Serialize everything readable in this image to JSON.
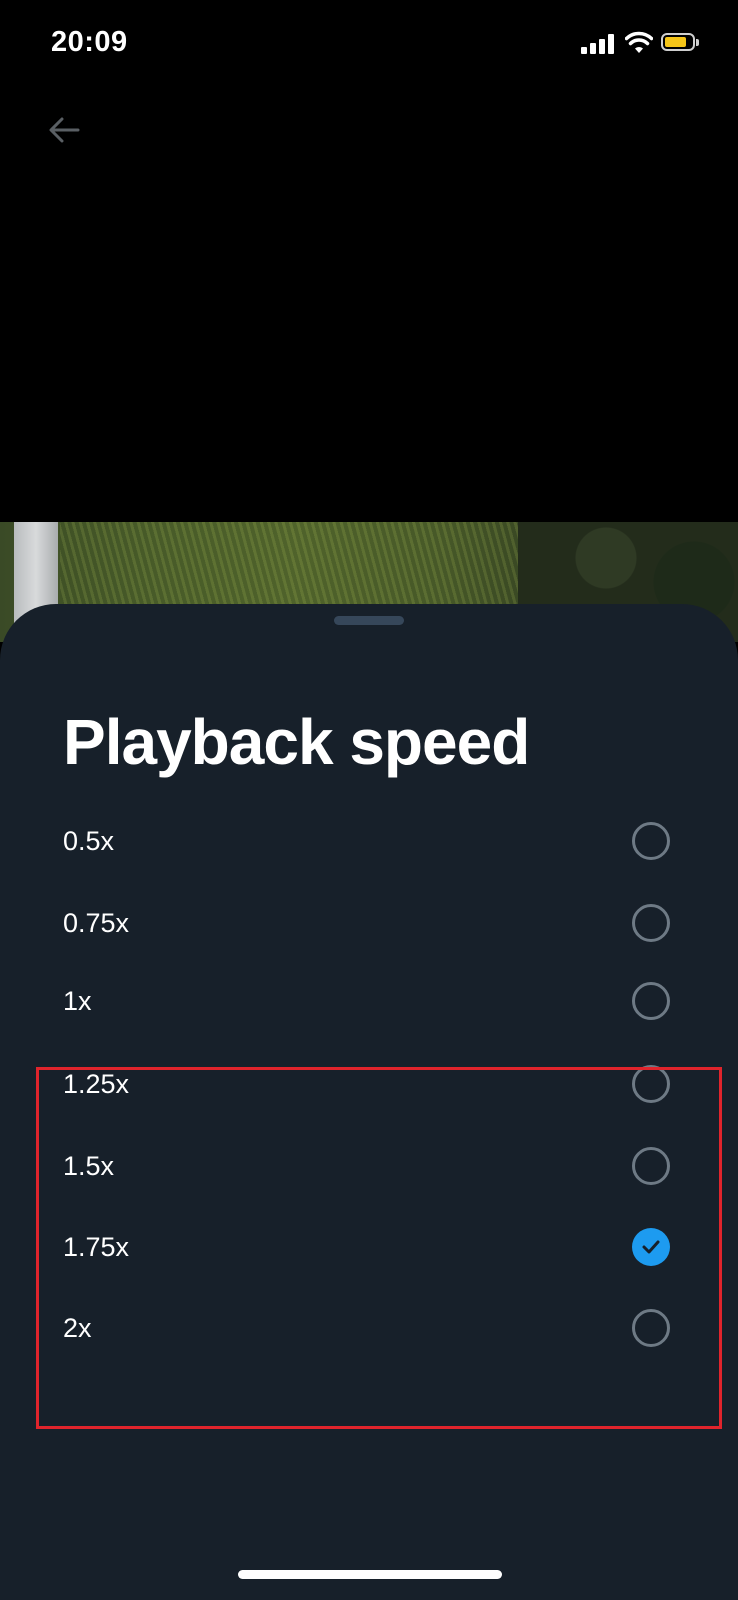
{
  "status_bar": {
    "time": "20:09",
    "battery_color": "#f5c518"
  },
  "nav": {
    "back_icon": "arrow-left-icon"
  },
  "sheet": {
    "title": "Playback speed",
    "accent_color": "#1d9bf0",
    "selected": "1.75x",
    "options": [
      {
        "label": "0.5x",
        "selected": false
      },
      {
        "label": "0.75x",
        "selected": false
      },
      {
        "label": "1x",
        "selected": false
      },
      {
        "label": "1.25x",
        "selected": false
      },
      {
        "label": "1.5x",
        "selected": false
      },
      {
        "label": "1.75x",
        "selected": true
      },
      {
        "label": "2x",
        "selected": false
      }
    ]
  }
}
